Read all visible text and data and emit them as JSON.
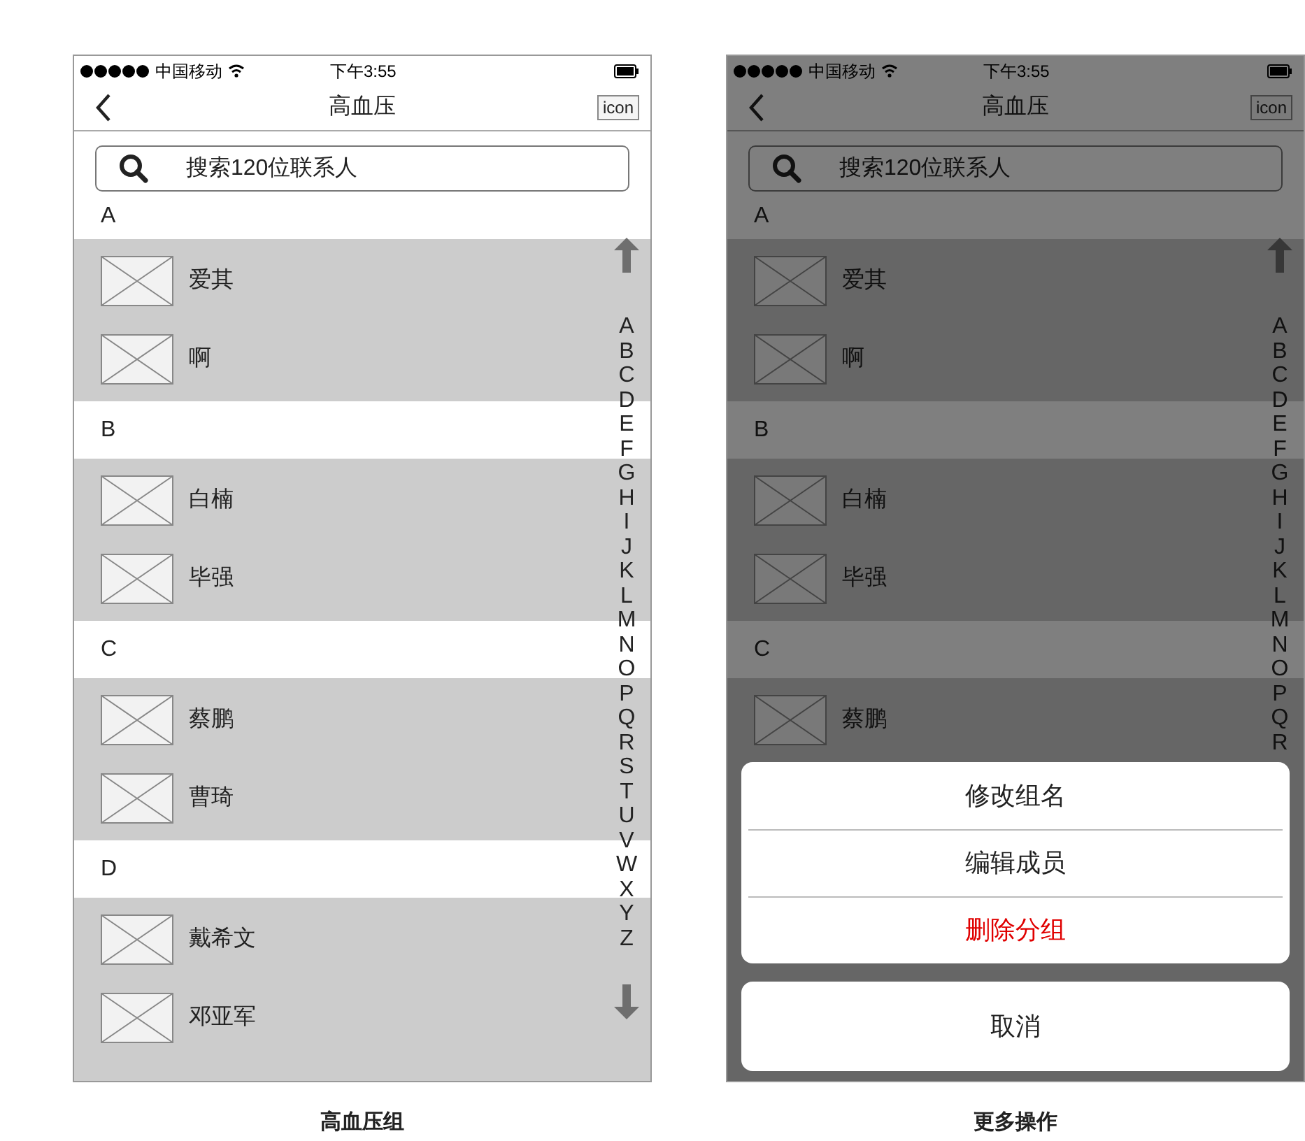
{
  "screens": [
    {
      "caption": "高血压组",
      "status_bar": {
        "carrier": "中国移动",
        "time": "下午3:55"
      },
      "nav": {
        "title": "高血压",
        "right_button": "icon"
      },
      "search": {
        "placeholder": "搜索120位联系人"
      },
      "sections": [
        {
          "letter": "A",
          "contacts": [
            {
              "name": "爱其"
            },
            {
              "name": "啊"
            }
          ]
        },
        {
          "letter": "B",
          "contacts": [
            {
              "name": "白楠"
            },
            {
              "name": "毕强"
            }
          ]
        },
        {
          "letter": "C",
          "contacts": [
            {
              "name": "蔡鹏"
            },
            {
              "name": "曹琦"
            }
          ]
        },
        {
          "letter": "D",
          "contacts": [
            {
              "name": "戴希文"
            },
            {
              "name": "邓亚军"
            }
          ]
        }
      ],
      "index": [
        "A",
        "B",
        "C",
        "D",
        "E",
        "F",
        "G",
        "H",
        "I",
        "J",
        "K",
        "L",
        "M",
        "N",
        "O",
        "P",
        "Q",
        "R",
        "S",
        "T",
        "U",
        "V",
        "W",
        "X",
        "Y",
        "Z"
      ]
    },
    {
      "caption": "更多操作",
      "status_bar": {
        "carrier": "中国移动",
        "time": "下午3:55"
      },
      "nav": {
        "title": "高血压",
        "right_button": "icon"
      },
      "search": {
        "placeholder": "搜索120位联系人"
      },
      "sections": [
        {
          "letter": "A",
          "contacts": [
            {
              "name": "爱其"
            },
            {
              "name": "啊"
            }
          ]
        },
        {
          "letter": "B",
          "contacts": [
            {
              "name": "白楠"
            },
            {
              "name": "毕强"
            }
          ]
        },
        {
          "letter": "C",
          "contacts": [
            {
              "name": "蔡鹏"
            }
          ]
        }
      ],
      "index": [
        "A",
        "B",
        "C",
        "D",
        "E",
        "F",
        "G",
        "H",
        "I",
        "J",
        "K",
        "L",
        "M",
        "N",
        "O",
        "P",
        "Q",
        "R"
      ],
      "action_sheet": {
        "actions": [
          {
            "label": "修改组名",
            "destructive": false
          },
          {
            "label": "编辑成员",
            "destructive": false
          },
          {
            "label": "删除分组",
            "destructive": true
          }
        ],
        "cancel": "取消"
      }
    }
  ]
}
